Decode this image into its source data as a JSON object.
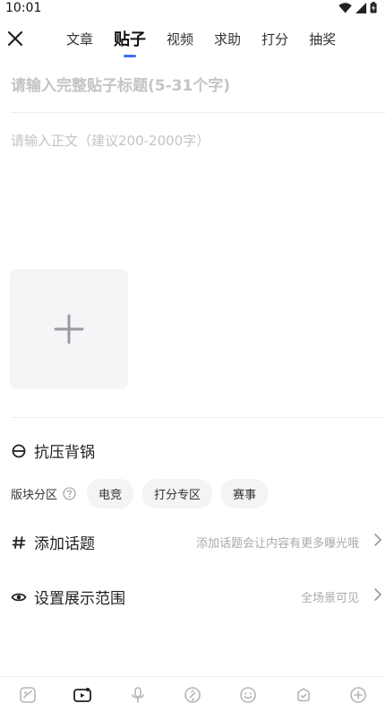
{
  "status": {
    "time": "10:01"
  },
  "tabs": [
    "文章",
    "贴子",
    "视频",
    "求助",
    "打分",
    "抽奖"
  ],
  "active_tab": "贴子",
  "editor": {
    "title_placeholder": "请输入完整贴子标题(5-31个字)",
    "body_placeholder": "请输入正文（建议200-2000字）"
  },
  "circle": {
    "name": "抗压背锅"
  },
  "section": {
    "label": "版块分区",
    "chips": [
      "电竞",
      "打分专区",
      "赛事"
    ]
  },
  "topic": {
    "title": "添加话题",
    "hint": "添加话题会让内容有更多曝光哦"
  },
  "visibility": {
    "title": "设置展示范围",
    "value": "全场景可见"
  },
  "toolbar_icons": [
    "sticker-icon",
    "video-icon",
    "microphone-icon",
    "link-icon",
    "emoji-icon",
    "vote-icon",
    "more-plus-icon"
  ],
  "colors": {
    "accent": "#3d6df2",
    "placeholder": "#c4c4c8",
    "hint": "#aaaaaa",
    "chip_bg": "#f4f4f6"
  }
}
